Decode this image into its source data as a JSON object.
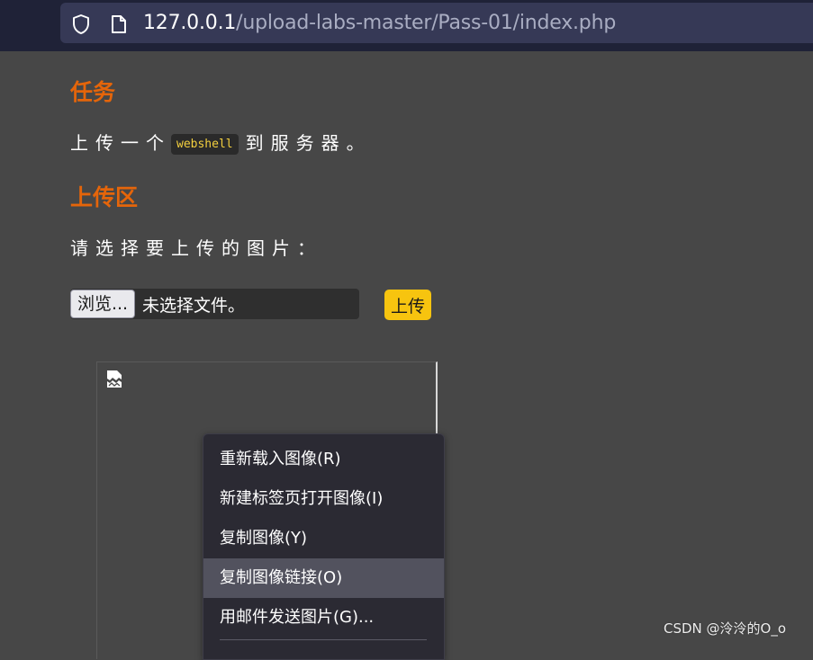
{
  "browser": {
    "url_host": "127.0.0.1",
    "url_path": "/upload-labs-master/Pass-01/index.php",
    "icons": [
      "shield-icon",
      "page-icon"
    ]
  },
  "task": {
    "heading": "任务",
    "text_before": "上传一个",
    "code": "webshell",
    "text_after": "到服务器。"
  },
  "upload": {
    "heading": "上传区",
    "prompt": "请选择要上传的图片：",
    "browse_label": "浏览...",
    "no_file_text": "未选择文件。",
    "submit_label": "上传"
  },
  "image": {
    "icon": "broken-image-icon"
  },
  "context_menu": {
    "items": [
      {
        "label": "重新载入图像(R)"
      },
      {
        "label": "新建标签页打开图像(I)"
      },
      {
        "label": "复制图像(Y)"
      },
      {
        "label": "复制图像链接(O)"
      },
      {
        "label": "用邮件发送图片(G)..."
      }
    ]
  },
  "watermark": "CSDN @泠泠的O_o"
}
